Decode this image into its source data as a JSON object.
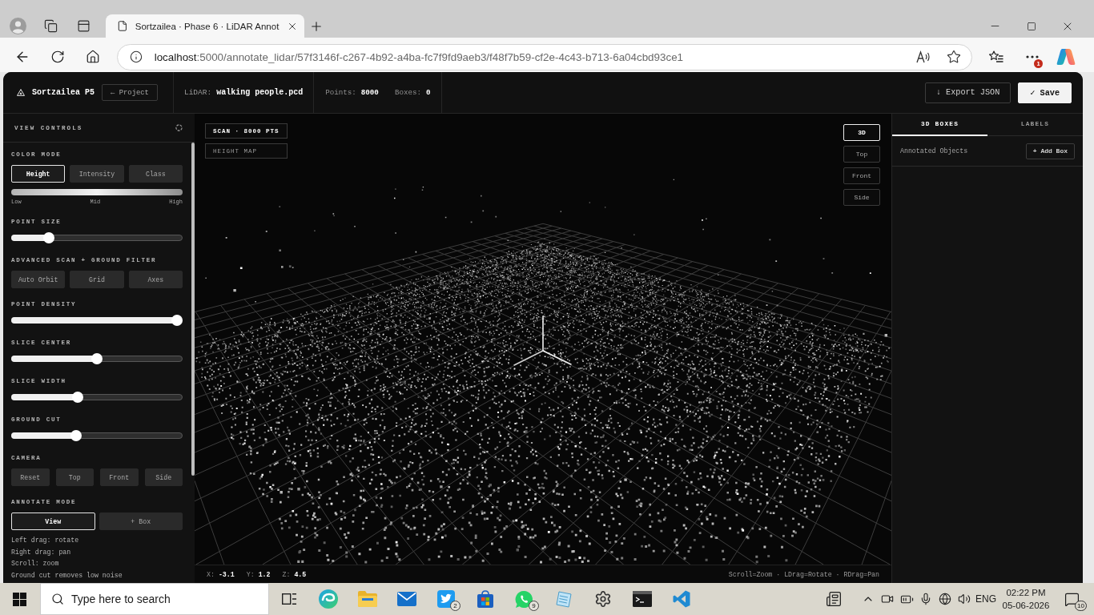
{
  "browser": {
    "tab": {
      "title": "Sortzailea · Phase 6 · LiDAR Annot"
    },
    "address": {
      "host": "localhost",
      "path": ":5000/annotate_lidar/57f3146f-c267-4b92-a4ba-fc7f9fd9aeb3/f48f7b59-cf2e-4c43-b713-6a04cbd93ce1"
    },
    "menu_badge": "1"
  },
  "header": {
    "app_name": "Sortzailea P5",
    "back_button": "← Project",
    "file_label": "LiDAR:",
    "file_name": "walking people.pcd",
    "stats": [
      {
        "label": "Points:",
        "value": "8000"
      },
      {
        "label": "Boxes:",
        "value": "0"
      }
    ],
    "actions": [
      {
        "label": "↓ Export JSON",
        "kind": "outline"
      },
      {
        "label": "✓ Save",
        "kind": "primary"
      }
    ]
  },
  "sidebar": {
    "title": "VIEW CONTROLS",
    "sections": [
      {
        "kind": "buttons",
        "title": "COLOR MODE",
        "buttons": [
          {
            "label": "Height",
            "selected": true
          },
          {
            "label": "Intensity",
            "selected": false
          },
          {
            "label": "Class",
            "selected": false
          }
        ]
      },
      {
        "kind": "legend",
        "labels": [
          "Low",
          "Mid",
          "High"
        ]
      },
      {
        "kind": "slider",
        "title": "POINT SIZE",
        "level": 0.2
      },
      {
        "kind": "buttons",
        "title": "ADVANCED SCAN + GROUND FILTER",
        "buttons": [
          {
            "label": "Auto Orbit",
            "selected": false
          },
          {
            "label": "Grid",
            "selected": false
          },
          {
            "label": "Axes",
            "selected": false
          }
        ]
      },
      {
        "kind": "slider",
        "title": "POINT DENSITY",
        "level": 1
      },
      {
        "kind": "slider",
        "title": "SLICE CENTER",
        "level": 0.5
      },
      {
        "kind": "slider",
        "title": "SLICE WIDTH",
        "level": 0.38
      },
      {
        "kind": "slider",
        "title": "GROUND CUT",
        "level": 0.37
      },
      {
        "kind": "buttons",
        "title": "CAMERA",
        "buttons": [
          {
            "label": "Reset"
          },
          {
            "label": "Top"
          },
          {
            "label": "Front"
          },
          {
            "label": "Side"
          }
        ]
      },
      {
        "kind": "buttons",
        "title": "ANNOTATE MODE",
        "buttons": [
          {
            "label": "View",
            "selected": true
          },
          {
            "label": "+ Box",
            "selected": false
          }
        ]
      },
      {
        "kind": "help",
        "lines": [
          "Left drag: rotate",
          "Right drag: pan",
          "Scroll: zoom",
          "Ground cut removes low noise"
        ]
      }
    ]
  },
  "viewport": {
    "badges": [
      {
        "label": "SCAN · 8000 PTS",
        "kind": "strong"
      },
      {
        "label": "HEIGHT MAP",
        "kind": "muted"
      }
    ],
    "views": [
      {
        "label": "3D",
        "selected": true
      },
      {
        "label": "Top",
        "selected": false
      },
      {
        "label": "Front",
        "selected": false
      },
      {
        "label": "Side",
        "selected": false
      }
    ],
    "coords": [
      {
        "label": "X:",
        "value": "-3.1"
      },
      {
        "label": "Y:",
        "value": "1.2"
      },
      {
        "label": "Z:",
        "value": "4.5"
      }
    ],
    "hint": "Scroll=Zoom · LDrag=Rotate · RDrag=Pan"
  },
  "objects_panel": {
    "tabs": [
      {
        "label": "3D BOXES",
        "selected": true
      },
      {
        "label": "LABELS",
        "selected": false
      }
    ],
    "list_title": "Annotated Objects",
    "add_button": "+ Add Box"
  },
  "taskbar": {
    "search": {
      "placeholder": "Type here to search"
    },
    "app_badges": [
      "2",
      "9"
    ],
    "language": "ENG",
    "time": "02:22 PM",
    "date": "05-06-2026",
    "notifications": "10"
  }
}
